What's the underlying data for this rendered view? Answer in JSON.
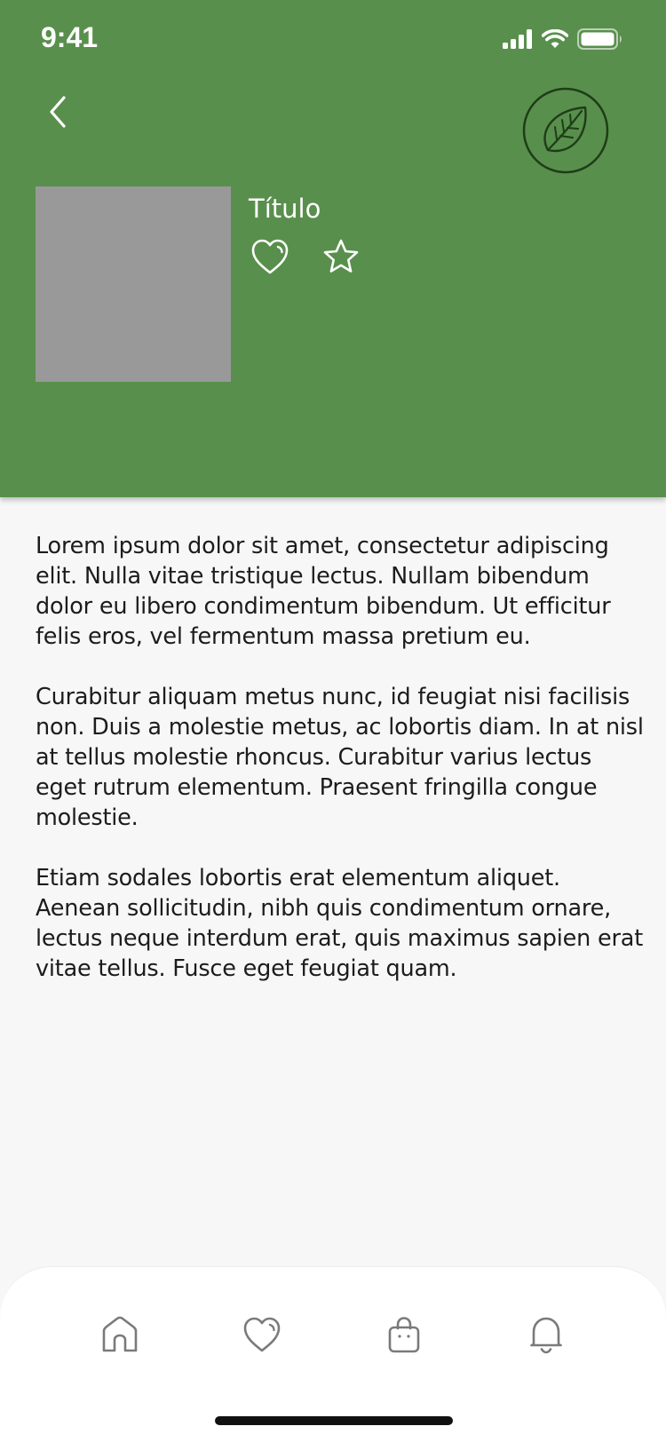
{
  "status_bar": {
    "time": "9:41"
  },
  "product": {
    "title": "Título"
  },
  "description": {
    "paragraphs": [
      "Lorem ipsum dolor sit amet, consectetur adipiscing elit. Nulla vitae  tristique lectus. Nullam bibendum dolor eu libero condimentum bibendum.  Ut efficitur felis eros, vel fermentum massa pretium eu.",
      "Curabitur  aliquam metus nunc, id feugiat nisi facilisis non. Duis a molestie  metus, ac lobortis diam. In at nisl at tellus molestie rhoncus. Curabitur varius lectus eget rutrum elementum. Praesent fringilla congue molestie.",
      "Etiam sodales lobortis erat elementum aliquet. Aenean  sollicitudin, nibh quis condimentum ornare, lectus neque interdum erat,  quis maximus sapien erat vitae tellus. Fusce eget feugiat quam."
    ]
  },
  "tab_bar": {
    "items": [
      {
        "icon": "home-icon"
      },
      {
        "icon": "heart-icon"
      },
      {
        "icon": "shopping-bag-icon"
      },
      {
        "icon": "bell-icon"
      }
    ]
  },
  "colors": {
    "header_background": "#588f4c",
    "thumbnail_placeholder": "#999999",
    "leaf_badge": "#1e3d17",
    "page_background": "#f7f7f7",
    "tab_icon": "#7a7a7a"
  }
}
